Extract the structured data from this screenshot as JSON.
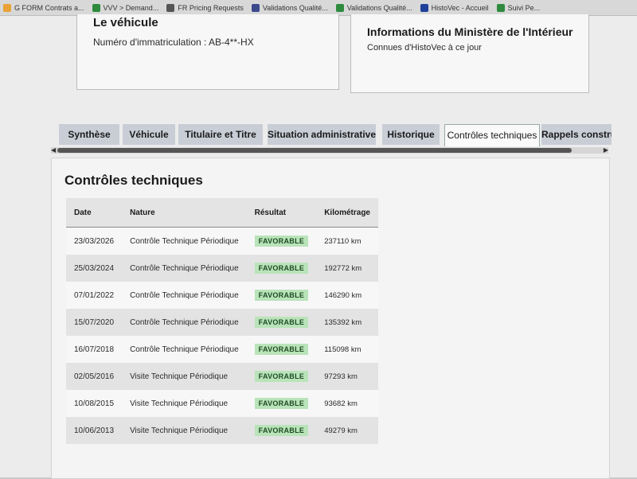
{
  "bookmarks": [
    {
      "label": "G FORM Contrats a...",
      "icon": "gform-icon",
      "color": "#e8a236"
    },
    {
      "label": "VVV > Demand...",
      "icon": "sheet-icon",
      "color": "#2e8b3e"
    },
    {
      "label": "FR Pricing Requests",
      "icon": "doc-icon",
      "color": "#555555"
    },
    {
      "label": "Validations Qualité...",
      "icon": "doc-icon",
      "color": "#3a4a8a"
    },
    {
      "label": "Validations Qualité...",
      "icon": "sheet-icon",
      "color": "#2e8b3e"
    },
    {
      "label": "HistoVec - Accueil",
      "icon": "flag-icon",
      "color": "#1f3f9a"
    },
    {
      "label": "Suivi Pe...",
      "icon": "sheet-icon",
      "color": "#2e8b3e"
    }
  ],
  "vehicle_card": {
    "title": "Le véhicule",
    "plate_label": "Numéro d'immatriculation : AB-4**-HX"
  },
  "ministry_card": {
    "title": "Informations du Ministère de l'Intérieur",
    "subtitle": "Connues d'HistoVec à ce jour"
  },
  "tabs": [
    {
      "label": "Synthèse",
      "active": false
    },
    {
      "label": "Véhicule",
      "active": false
    },
    {
      "label": "Titulaire et Titre",
      "active": false
    },
    {
      "label": "Situation administrative",
      "active": false
    },
    {
      "label": "Historique",
      "active": false
    },
    {
      "label": "Contrôles techniques",
      "active": true
    },
    {
      "label": "Rappels constru",
      "active": false
    }
  ],
  "section_title": "Contrôles techniques",
  "table": {
    "headers": [
      "Date",
      "Nature",
      "Résultat",
      "Kilométrage"
    ],
    "rows": [
      {
        "date": "23/03/2026",
        "nature": "Contrôle Technique Périodique",
        "result": "FAVORABLE",
        "km": "237110 km"
      },
      {
        "date": "25/03/2024",
        "nature": "Contrôle Technique Périodique",
        "result": "FAVORABLE",
        "km": "192772 km"
      },
      {
        "date": "07/01/2022",
        "nature": "Contrôle Technique Périodique",
        "result": "FAVORABLE",
        "km": "146290 km"
      },
      {
        "date": "15/07/2020",
        "nature": "Contrôle Technique Périodique",
        "result": "FAVORABLE",
        "km": "135392 km"
      },
      {
        "date": "16/07/2018",
        "nature": "Contrôle Technique Périodique",
        "result": "FAVORABLE",
        "km": "115098 km"
      },
      {
        "date": "02/05/2016",
        "nature": "Visite Technique Périodique",
        "result": "FAVORABLE",
        "km": "97293 km"
      },
      {
        "date": "10/08/2015",
        "nature": "Visite Technique Périodique",
        "result": "FAVORABLE",
        "km": "93682 km"
      },
      {
        "date": "10/06/2013",
        "nature": "Visite Technique Périodique",
        "result": "FAVORABLE",
        "km": "49279 km"
      }
    ]
  },
  "colors": {
    "badge_bg": "#b9e3b9",
    "badge_text": "#1d4d24",
    "tab_bg": "#c8cdd6"
  }
}
